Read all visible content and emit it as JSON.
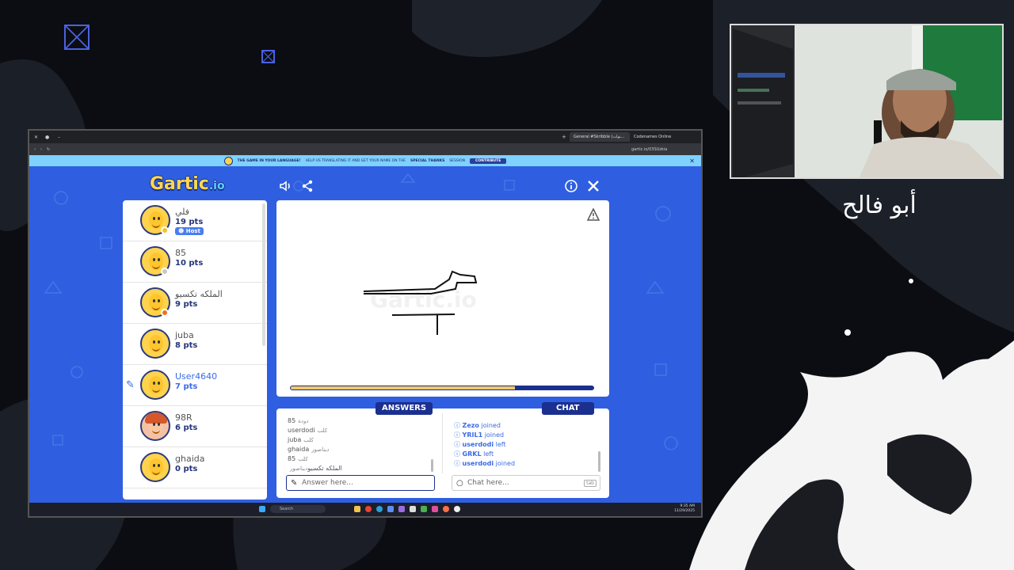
{
  "streamer": {
    "name": "أبو فالح"
  },
  "browser": {
    "tabs": [
      {
        "label": "General #Skribble (قنوات) - Gartic"
      },
      {
        "label": "Codenames Online"
      }
    ],
    "url": "gartic.io/03SUzkia",
    "banner": {
      "text1": "THE GAME IN YOUR LANGUAGE!",
      "text2": "HELP US TRANSLATING IT AND GET YOUR NAME ON THE",
      "text3": "SPECIAL THANKS",
      "text4": "SESSION",
      "button": "CONTRIBUTE"
    }
  },
  "game": {
    "logo": "Gartic",
    "logo_suffix": ".io",
    "players": [
      {
        "name": "فلي",
        "pts": "19 pts",
        "badge": "Host",
        "dot": "#f5c22e"
      },
      {
        "name": "85",
        "pts": "10 pts",
        "dot": "#c8c8c8"
      },
      {
        "name": "الملكه تكسيو",
        "pts": "9 pts",
        "dot": "#e8741f"
      },
      {
        "name": "juba",
        "pts": "8 pts"
      },
      {
        "name": "User4640",
        "pts": "7 pts",
        "me": true
      },
      {
        "name": "98R",
        "pts": "6 pts"
      },
      {
        "name": "ghaida",
        "pts": "0 pts"
      }
    ],
    "progress": 0.74,
    "answers_tab": "ANSWERS",
    "chat_tab": "CHAT",
    "answers": [
      {
        "name": "85",
        "guess": "دودة"
      },
      {
        "name": "userdodi",
        "guess": "كلب"
      },
      {
        "name": "juba",
        "guess": "كلب"
      },
      {
        "name": "ghaida",
        "guess": "ديناصور"
      },
      {
        "name": "85",
        "guess": "كلب"
      },
      {
        "name": "الملكه تكسيو",
        "guess": "ديناصور"
      }
    ],
    "chat": [
      {
        "name": "Zezo",
        "action": "joined"
      },
      {
        "name": "YRIL1",
        "action": "joined"
      },
      {
        "name": "userdodi",
        "action": "left"
      },
      {
        "name": "GRKL",
        "action": "left"
      },
      {
        "name": "userdodi",
        "action": "joined"
      }
    ],
    "answer_placeholder": "Answer here...",
    "chat_placeholder": "Chat here...",
    "tab_key": "tab"
  },
  "taskbar": {
    "search": "Search",
    "time": "9:35 AM",
    "date": "11/29/2025"
  },
  "colors": {
    "game_bg": "#2f5fe0",
    "accent": "#1b2f8e",
    "progress": "#f1c66a"
  }
}
